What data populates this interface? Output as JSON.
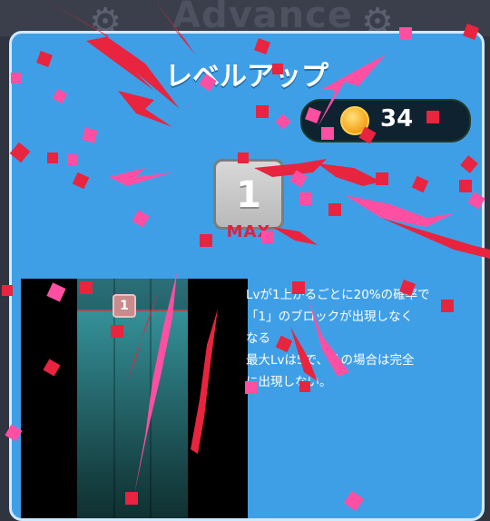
{
  "background": {
    "ghost_title": "Advance"
  },
  "panel": {
    "title": "レベルアップ"
  },
  "coins": {
    "icon": "coin-icon",
    "count": "34"
  },
  "level": {
    "value": "1",
    "max_label": "MAX"
  },
  "preview": {
    "block_label": "1"
  },
  "description": {
    "line1": "Lvが1上がるごとに20%の確率で",
    "line2": "「1」のブロックが出現しなく",
    "line3": "なる",
    "line4": "最大Lvは5で、その場合は完全",
    "line5": "に出現しない。"
  },
  "colors": {
    "panel": "#3f9fe6",
    "confetti_red": "#e8243f",
    "confetti_pink": "#ff4fa3",
    "max_red": "#e0223b"
  }
}
